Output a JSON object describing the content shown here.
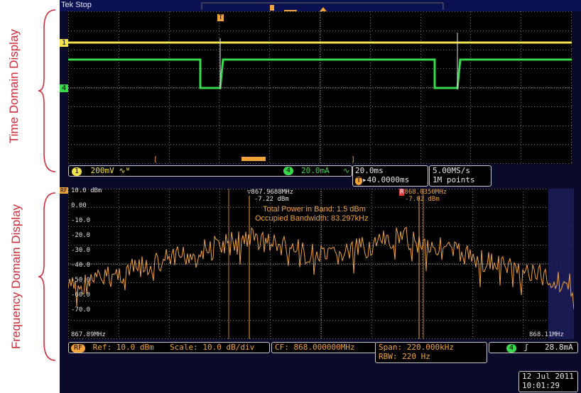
{
  "labels": {
    "time_domain": "Time Domain Display",
    "frequency_domain": "Frequency Domain Display"
  },
  "topbar": {
    "brand": "Tek",
    "status": "Stop",
    "trigger_marker": "T"
  },
  "time_domain": {
    "ch1_marker": "1",
    "ch4_marker": "4",
    "ch1": {
      "badge": "1",
      "scale": "200mV",
      "coupling_icon": "∿ᵂ"
    },
    "ch4": {
      "badge": "4",
      "scale": "20.0mA",
      "coupling_icon": "∿"
    },
    "horizontal": {
      "scale": "20.0ms",
      "delay": "▸40.0000ms"
    },
    "acquisition": {
      "rate": "5.00MS/s",
      "points": "1M points"
    }
  },
  "frequency_domain": {
    "rf_marker": "RF",
    "y_ticks": [
      "10.0 dBm",
      "0.00",
      "-10.0",
      "-20.0",
      "-30.0",
      "-40.0",
      "-50.0",
      "-60.0",
      "-70.0"
    ],
    "x_start": "867.89MHz",
    "x_end": "868.11MHz",
    "marker1": {
      "symbol": "▽",
      "freq": "867.9688MHz",
      "level": "-7.22 dBm"
    },
    "marker2": {
      "symbol": "R",
      "freq": "868.0350MHz",
      "level": "-7.02 dBm"
    },
    "total_power": "Total Power in Band: 1.5 dBm",
    "occupied_bw": "Occupied Bandwidth: 83.297kHz",
    "ref": {
      "badge": "RF",
      "ref": "Ref: 10.0 dBm",
      "scale": "Scale: 10.0 dB/div"
    },
    "cf": "CF: 868.000000MHz",
    "span": "Span:  220.000kHz",
    "rbw": "RBW:   220 Hz",
    "trigger": {
      "badge": "4",
      "slope": "ʃ",
      "level": "28.8mA"
    }
  },
  "datetime": {
    "date": "12 Jul  2011",
    "time": "10:01:29"
  },
  "colors": {
    "ch1": "#f2e24b",
    "ch4": "#38d94d",
    "rf": "#f2a43c",
    "annotation": "#d12a3a"
  }
}
